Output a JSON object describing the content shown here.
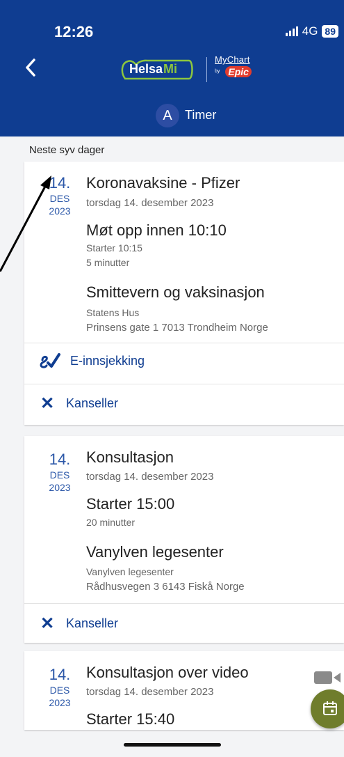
{
  "status_bar": {
    "time": "12:26",
    "network": "4G",
    "battery": "89"
  },
  "header": {
    "logo_helsa": "Helsa",
    "logo_mi": "Mi",
    "logo_mychart": "MyChart",
    "logo_by": "by",
    "logo_epic": "Epic",
    "avatar_letter": "A",
    "title": "Timer"
  },
  "section_label": "Neste syv dager",
  "appointments": [
    {
      "day": "14.",
      "month": "DES",
      "year": "2023",
      "title": "Koronavaksine - Pfizer",
      "date_text": "torsdag 14. desember 2023",
      "time_heading": "Møt opp innen 10:10",
      "start_text": "Starter 10:15",
      "duration": "5 minutter",
      "place": "Smittevern og vaksinasjon",
      "place_detail": "Statens Hus",
      "address": "Prinsens gate 1 7013 Trondheim  Norge",
      "echeckin_label": "E-innsjekking",
      "cancel_label": "Kanseller"
    },
    {
      "day": "14.",
      "month": "DES",
      "year": "2023",
      "title": "Konsultasjon",
      "date_text": "torsdag 14. desember 2023",
      "time_heading": "Starter 15:00",
      "duration": "20 minutter",
      "place": "Vanylven legesenter",
      "place_detail": "Vanylven legesenter",
      "address": "Rådhusvegen 3 6143 Fiskå Norge",
      "cancel_label": "Kanseller"
    },
    {
      "day": "14.",
      "month": "DES",
      "year": "2023",
      "title": "Konsultasjon over video",
      "date_text": "torsdag 14. desember 2023",
      "time_heading": "Starter 15:40"
    }
  ],
  "colors": {
    "header_bg": "#0f3d91",
    "accent": "#2b57a8",
    "fab": "#6f7d2c",
    "epic": "#e23c2d"
  }
}
